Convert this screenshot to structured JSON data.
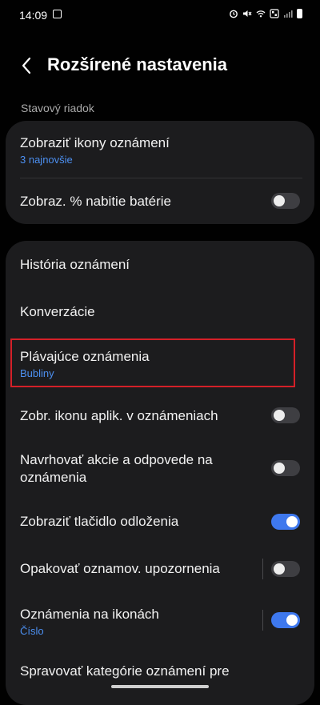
{
  "status_bar": {
    "time": "14:09",
    "icons": [
      "image-icon",
      "alarm-icon",
      "mute-icon",
      "wifi-icon",
      "data-icon",
      "signal-icon",
      "battery-icon"
    ]
  },
  "header": {
    "title": "Rozšírené nastavenia",
    "back_icon": "chevron-left-icon"
  },
  "section_label": "Stavový riadok",
  "status_card": {
    "notification_icons": {
      "label": "Zobraziť ikony oznámení",
      "value": "3 najnovšie"
    },
    "battery_percent": {
      "label": "Zobraz. % nabitie batérie",
      "enabled": false
    }
  },
  "notif_card": {
    "history": {
      "label": "História oznámení"
    },
    "conversations": {
      "label": "Konverzácie"
    },
    "floating": {
      "label": "Plávajúce oznámenia",
      "value": "Bubliny"
    },
    "app_icon": {
      "label": "Zobr. ikonu aplik. v oznámeniach",
      "enabled": false
    },
    "suggest": {
      "label_line1": "Navrhovať akcie a odpovede na",
      "label_line2": "oznámenia",
      "enabled": false
    },
    "snooze": {
      "label": "Zobraziť tlačidlo odloženia",
      "enabled": true
    },
    "repeat": {
      "label": "Opakovať oznamov. upozornenia",
      "enabled": false
    },
    "badges": {
      "label": "Oznámenia na ikonách",
      "value": "Číslo",
      "enabled": true
    },
    "categories": {
      "label": "Spravovať kategórie oznámení pre"
    }
  },
  "colors": {
    "background": "#010101",
    "card": "#1c1c1e",
    "accent_blue": "#4c8ff0",
    "toggle_on": "#3e78ee",
    "highlight_red": "#d42028"
  }
}
